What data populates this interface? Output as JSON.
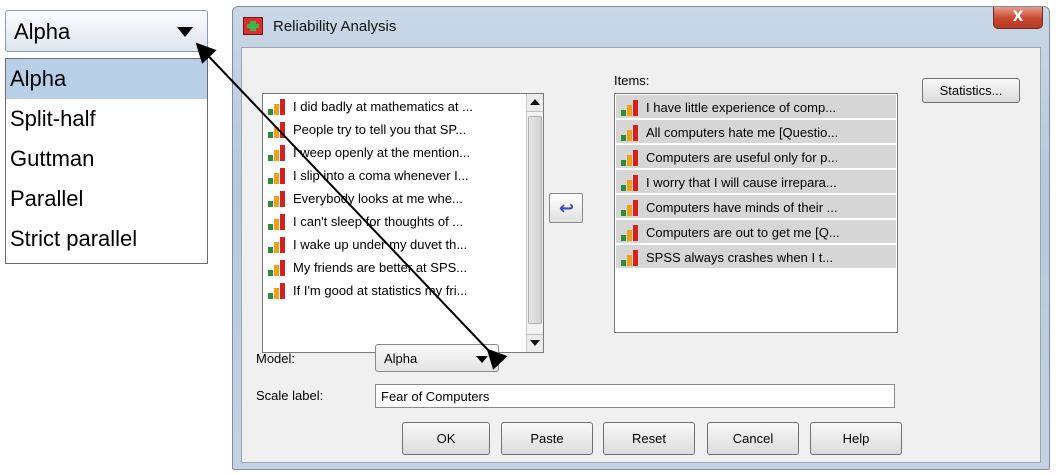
{
  "zoom": {
    "selected_value": "Alpha",
    "options": [
      "Alpha",
      "Split-half",
      "Guttman",
      "Parallel",
      "Strict parallel"
    ]
  },
  "window": {
    "title": "Reliability Analysis",
    "close_label": "X"
  },
  "source_list": {
    "items": [
      "I did badly at mathematics at ...",
      "People try to tell you that SP...",
      "I weep openly at the mention...",
      "I slip into a coma whenever I...",
      "Everybody looks at me whe...",
      "I can't sleep for thoughts of ...",
      "I wake up under my duvet th...",
      "My friends are better at SPS...",
      "If I'm good at statistics my fri..."
    ]
  },
  "items_panel": {
    "label": "Items:",
    "items": [
      "I have little experience of comp...",
      "All computers hate me [Questio...",
      "Computers are useful only for p...",
      "I worry that I will cause irrepara...",
      "Computers have minds of their ...",
      "Computers are out to get me [Q...",
      "SPSS always crashes when I t..."
    ]
  },
  "buttons": {
    "statistics": "Statistics...",
    "ok": "OK",
    "paste": "Paste",
    "reset": "Reset",
    "cancel": "Cancel",
    "help": "Help",
    "move": "↩"
  },
  "model": {
    "label": "Model:",
    "value": "Alpha"
  },
  "scale_label": {
    "label": "Scale label:",
    "value": "Fear of Computers"
  },
  "colors": {
    "selected": "#b8cfe8",
    "target_row": "#d6d6d6",
    "move_arrow": "#3a4fb8",
    "close": "#c8462e"
  },
  "icons": {
    "variable": "scale-variable-icon",
    "move": "move-arrow-icon"
  }
}
